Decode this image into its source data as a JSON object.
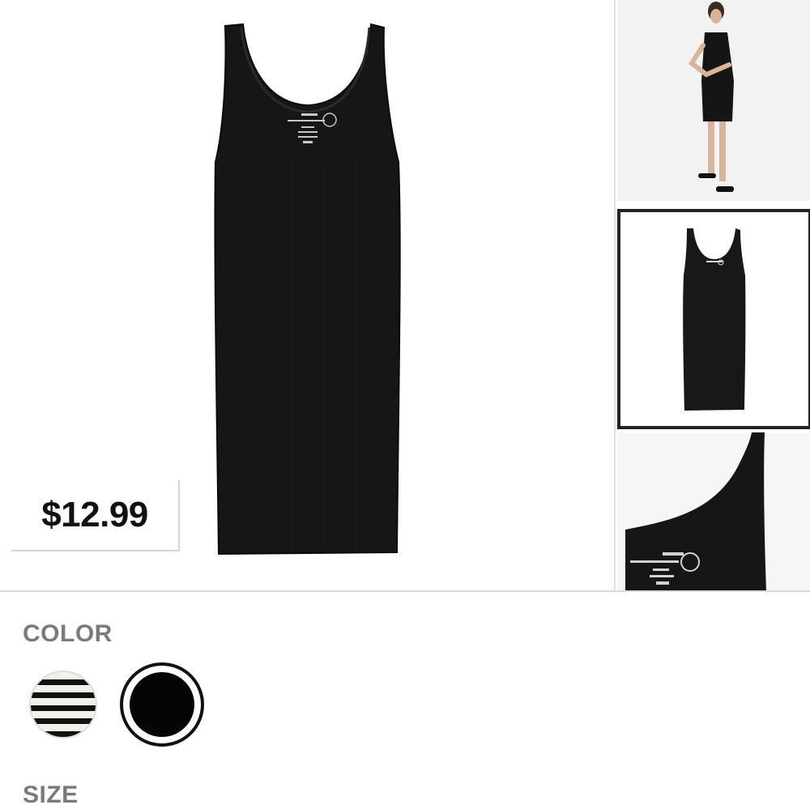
{
  "product": {
    "price": "$12.99",
    "main_image": "black-tank-dress-front",
    "thumbnails": [
      {
        "name": "model-wearing-dress",
        "selected": false
      },
      {
        "name": "dress-front-small",
        "selected": true
      },
      {
        "name": "dress-neckline-detail",
        "selected": false
      }
    ]
  },
  "options": {
    "color_label": "COLOR",
    "size_label": "SIZE",
    "colors": [
      {
        "name": "black-white-striped",
        "selected": false
      },
      {
        "name": "black",
        "selected": true
      }
    ]
  },
  "colors": {
    "dress": "#141414",
    "price_text": "#111111",
    "label_text": "#7a7a7a",
    "selected_border": "#222222"
  }
}
